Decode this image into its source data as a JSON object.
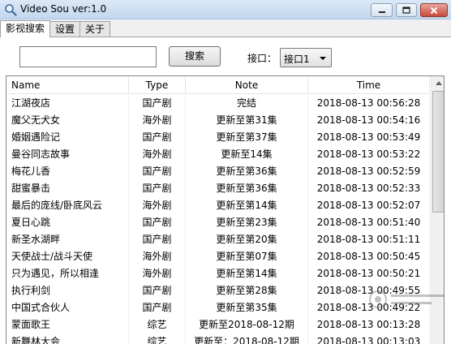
{
  "window": {
    "title": "Video Sou  ver:1.0"
  },
  "tabs": [
    {
      "label": "影视搜索",
      "active": true
    },
    {
      "label": "设置",
      "active": false
    },
    {
      "label": "关于",
      "active": false
    }
  ],
  "search": {
    "value": "",
    "placeholder": "",
    "button_label": "搜索",
    "interface_label": "接口：",
    "interface_selected": "接口1"
  },
  "list": {
    "columns": [
      "Name",
      "Type",
      "Note",
      "Time"
    ],
    "rows": [
      {
        "name": "江湖夜店",
        "type": "国产剧",
        "note": "完结",
        "time": "2018-08-13 00:56:28"
      },
      {
        "name": "魔父无犬女",
        "type": "海外剧",
        "note": "更新至第31集",
        "time": "2018-08-13 00:54:16"
      },
      {
        "name": "婚姻遇险记",
        "type": "国产剧",
        "note": "更新至第37集",
        "time": "2018-08-13 00:53:49"
      },
      {
        "name": "曼谷同志故事",
        "type": "海外剧",
        "note": "更新至14集",
        "time": "2018-08-13 00:53:22"
      },
      {
        "name": "梅花儿香",
        "type": "国产剧",
        "note": "更新至第36集",
        "time": "2018-08-13 00:52:59"
      },
      {
        "name": "甜蜜暴击",
        "type": "国产剧",
        "note": "更新至第36集",
        "time": "2018-08-13 00:52:33"
      },
      {
        "name": "最后的庞线/卧底风云",
        "type": "海外剧",
        "note": "更新至第14集",
        "time": "2018-08-13 00:52:07"
      },
      {
        "name": "夏日心跳",
        "type": "国产剧",
        "note": "更新至第23集",
        "time": "2018-08-13 00:51:40"
      },
      {
        "name": "新圣水湖畔",
        "type": "国产剧",
        "note": "更新至第20集",
        "time": "2018-08-13 00:51:11"
      },
      {
        "name": "天使战士/战斗天使",
        "type": "海外剧",
        "note": "更新至第07集",
        "time": "2018-08-13 00:50:45"
      },
      {
        "name": "只为遇见，所以相逢",
        "type": "海外剧",
        "note": "更新至第14集",
        "time": "2018-08-13 00:50:21"
      },
      {
        "name": "执行利剑",
        "type": "国产剧",
        "note": "更新至第28集",
        "time": "2018-08-13 00:49:55"
      },
      {
        "name": "中国式合伙人",
        "type": "国产剧",
        "note": "更新至第35集",
        "time": "2018-08-13 00:49:22"
      },
      {
        "name": "蒙面歌王",
        "type": "综艺",
        "note": "更新至2018-08-12期",
        "time": "2018-08-13 00:13:28"
      },
      {
        "name": "新舞林大会",
        "type": "综艺",
        "note": "更新至：2018-08-12期",
        "time": "2018-08-13 00:13:03"
      }
    ]
  },
  "icons": {
    "app": "magnifier-icon",
    "minimize": "minimize-icon",
    "maximize": "maximize-icon",
    "close": "close-icon"
  },
  "colors": {
    "titlebar": "#c3d7ef",
    "close_button": "#c9493a",
    "list_border": "#828790"
  }
}
